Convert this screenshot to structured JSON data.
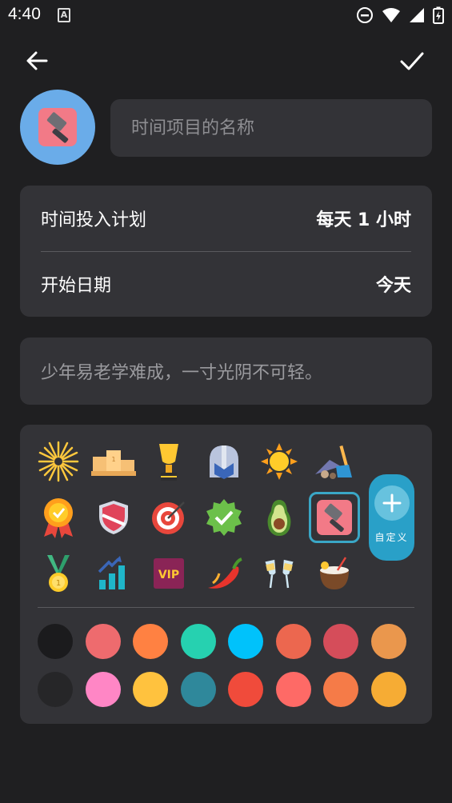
{
  "status_bar": {
    "time": "4:40",
    "notif_letter": "A"
  },
  "header": {
    "back_icon": "arrow-left-icon",
    "confirm_icon": "check-icon"
  },
  "project": {
    "avatar_icon": "hammer-icon",
    "avatar_color": "#6aace9",
    "name_placeholder": "时间项目的名称",
    "name_value": ""
  },
  "plan": {
    "time_label": "时间投入计划",
    "time_value": "每天 1 小时",
    "start_label": "开始日期",
    "start_value": "今天"
  },
  "note": {
    "placeholder": "少年易老学难成，一寸光阴不可轻。"
  },
  "icons": [
    [
      "fireworks-icon",
      "podium-icon",
      "trophy-icon",
      "helmet-icon",
      "sun-icon",
      "cleaning-icon"
    ],
    [
      "medal-badge-icon",
      "shield-icon",
      "target-icon",
      "check-badge-icon",
      "avocado-icon",
      "hammer-icon"
    ],
    [
      "gold-medal-icon",
      "chart-up-icon",
      "vip-icon",
      "chili-icon",
      "cheers-icon",
      "coconut-icon"
    ]
  ],
  "selected_icon": "hammer-icon",
  "custom_button": {
    "label": "自定义"
  },
  "colors": [
    [
      "#1b1b1d",
      "#ee6b6e",
      "#ff8142",
      "#26d1b0",
      "#00c2fb",
      "#ec674f",
      "#d54d5a",
      "#ea974d"
    ],
    [
      "#262628",
      "#ff86c5",
      "#ffc23e",
      "#2f889b",
      "#f04b3b",
      "#fe6a66",
      "#f57b48",
      "#f6ac34"
    ]
  ]
}
